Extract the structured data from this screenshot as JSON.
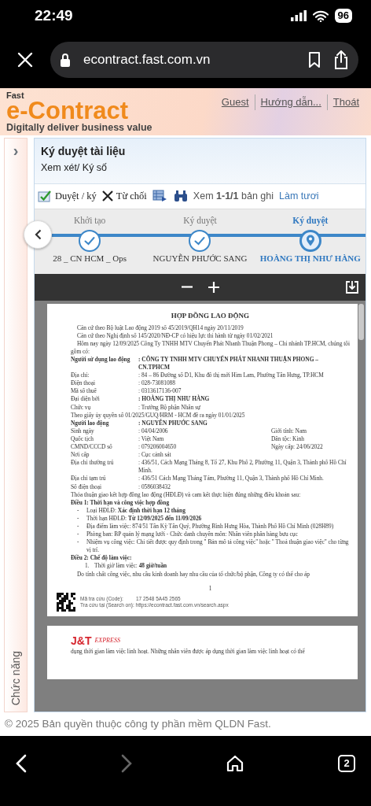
{
  "status_bar": {
    "time": "22:49",
    "battery": "96"
  },
  "browser": {
    "url": "econtract.fast.com.vn"
  },
  "header": {
    "brand_small": "Fast",
    "brand": "e-Contract",
    "tagline": "Digitally deliver business value",
    "links": [
      "Guest",
      "Hướng dẫn...",
      "Thoát"
    ]
  },
  "sidebar": {
    "toggle": "›",
    "label": "Chức năng"
  },
  "panel": {
    "title": "Ký duyệt tài liệu",
    "subtitle": "Xem xét/ Ký số"
  },
  "toolbar": {
    "actions": [
      {
        "kind": "approve",
        "label": "Duyệt / ký"
      },
      {
        "kind": "reject",
        "label": "Từ chối"
      },
      {
        "kind": "export"
      },
      {
        "kind": "find"
      }
    ],
    "records": "Xem **1-1/1** bản ghi",
    "refresh": "Làm tươi"
  },
  "steps": [
    {
      "label": "Khởi tạo",
      "name": "28 _ CN HCM _ Ops",
      "current": false
    },
    {
      "label": "Ký duyệt",
      "name": "NGUYỄN PHƯỚC SANG",
      "current": false
    },
    {
      "label": "Ký duyệt",
      "name": "HOÀNG THỊ NHƯ HÀNG",
      "current": true
    }
  ],
  "document": {
    "page1": [
      {
        "kind": "title",
        "text": "HỢP ĐỒNG LAO ĐỘNG"
      },
      {
        "kind": "para",
        "indent": true,
        "text": "Căn cứ theo Bộ luật Lao động 2019 số 45/2019/QH14 ngày 20/11/2019"
      },
      {
        "kind": "para",
        "indent": true,
        "text": "Căn cứ theo Nghị định số 145/2020/NĐ-CP có hiệu lực thi hành từ ngày 01/02/2021"
      },
      {
        "kind": "para",
        "indent": true,
        "text": "Hôm nay ngày 12/09/2025 Công Ty TNHH MTV Chuyển Phát Nhanh Thuận Phong – Chi nhánh TP.HCM, chúng tôi gồm có:"
      },
      {
        "kind": "field",
        "label": "Người sử dụng lao động",
        "value": ": CÔNG TY TNHH MTV CHUYỂN PHÁT NHANH THUẬN PHONG – CN.TPHCM",
        "label_bold": true,
        "value_bold": true
      },
      {
        "kind": "field",
        "label": "Địa chỉ:",
        "value": ": 84 – 86 Đường số D1, Khu đô thị mới Him Lam, Phường Tân Hưng, TP.HCM",
        "label_bold": false,
        "value_bold": false
      },
      {
        "kind": "field",
        "label": "Điện thoại",
        "value": ": 028-73081088",
        "label_bold": false,
        "value_bold": false
      },
      {
        "kind": "field",
        "label": "Mã số thuế",
        "value": ": 0313617136-007",
        "label_bold": false,
        "value_bold": false
      },
      {
        "kind": "field",
        "label": "Đại diện bởi",
        "value": ": HOÀNG THỊ NHƯ HÀNG",
        "label_bold": false,
        "value_bold": true
      },
      {
        "kind": "field",
        "label": "Chức vụ",
        "value": ": Trưởng Bộ phận Nhân sự",
        "label_bold": false,
        "value_bold": false
      },
      {
        "kind": "para",
        "indent": false,
        "text": "Theo giấy ủy quyền số 01/2025/GUQ/HRM - HCM đề ra ngày 01/01/2025"
      },
      {
        "kind": "field",
        "label": "Người lao động",
        "value": ": NGUYỄN PHƯỚC SANG",
        "label_bold": true,
        "value_bold": true
      },
      {
        "kind": "field",
        "label": "Sinh ngày",
        "value": ": 04/04/2006",
        "extra": "Giới tính: Nam",
        "label_bold": false,
        "value_bold": false
      },
      {
        "kind": "field",
        "label": "Quốc tịch",
        "value": ": Việt Nam",
        "extra": "Dân tộc: Kinh",
        "label_bold": false,
        "value_bold": false
      },
      {
        "kind": "field",
        "label": "CMND/CCCD số",
        "value": ": 079206004650",
        "extra": "Ngày cấp: 24/06/2022",
        "label_bold": false,
        "value_bold": false
      },
      {
        "kind": "field",
        "label": "Nơi cấp",
        "value": ": Cục cảnh sát",
        "label_bold": false,
        "value_bold": false
      },
      {
        "kind": "field",
        "label": "Địa chỉ thường trú",
        "value": ": 436/51, Cách Mạng Tháng 8, Tổ 27, Khu Phố 2, Phường 11, Quận 3, Thành phố Hồ Chí Minh.",
        "label_bold": false,
        "value_bold": false
      },
      {
        "kind": "field",
        "label": "Địa chỉ tạm trú",
        "value": ": 436/51 Cách Mạng Tháng Tám, Phường 11, Quận 3, Thành phố Hồ Chí Minh.",
        "label_bold": false,
        "value_bold": false
      },
      {
        "kind": "field",
        "label": "Số điện thoại",
        "value": ": 0586038432",
        "label_bold": false,
        "value_bold": false
      },
      {
        "kind": "para",
        "indent": false,
        "text": "Thỏa thuận giao kết hợp đồng lao động (HĐLĐ) và cam kết thực hiện đúng những điều khoản sau:"
      },
      {
        "kind": "heading",
        "text": "Điều 1: Thời hạn và công việc hợp đồng"
      },
      {
        "kind": "bullet",
        "marker": "-",
        "text": "Loại HĐLĐ: **Xác định thời hạn 12 tháng**"
      },
      {
        "kind": "bullet",
        "marker": "-",
        "text": "Thời hạn HĐLĐ: **Từ 12/09/2025 đến 11/09/2026**"
      },
      {
        "kind": "bullet",
        "marker": "-",
        "text": "Địa điểm làm việc: 874/51 Tân Kỳ Tân Quý, Phường Bình Hưng Hòa, Thành Phố Hồ Chí Minh (028H89)"
      },
      {
        "kind": "bullet",
        "marker": "-",
        "text": "Phòng ban: BP quản lý mạng lưới - Chức danh chuyên môn: Nhân viên phân hàng bưu cục"
      },
      {
        "kind": "bullet",
        "marker": "-",
        "text": "Nhiệm vụ công việc: Chi tiết được quy định trong \" Bản mô tả công việc\" hoặc \" Thoả thuận giao việc\" cho từng vị trí."
      },
      {
        "kind": "heading",
        "text": "Điều 2: Chế độ làm việc:"
      },
      {
        "kind": "numbered",
        "marker": "1.",
        "text": "Thời giờ làm việc: **48 giờ/tuần**"
      },
      {
        "kind": "para",
        "indent": true,
        "text": "Do tính chất công việc, nhu cầu kinh doanh hay nhu cầu của tổ chức/bộ phận, Công ty có thể cho áp"
      }
    ],
    "page_number": "1",
    "lookup_label": "Mã tra cứu (Code):",
    "lookup_code": "17 2548 5A45 2565",
    "search_line": "Tra cứu tại (Search on): https://econtract.fast.com.vn/search.aspx",
    "page2_logo": "J&T",
    "page2_logo_sub": "EXPRESS",
    "page2_text": "dụng thời gian làm việc linh hoạt. Những nhân viên được áp dụng thời gian làm việc linh hoạt có thể"
  },
  "footer": "© 2025 Bản quyền thuộc công ty phần mềm QLDN Fast.",
  "bottom_nav": [
    {
      "kind": "back",
      "disabled": false
    },
    {
      "kind": "forward",
      "disabled": true
    },
    {
      "kind": "home",
      "disabled": false
    },
    {
      "kind": "tabs",
      "count": "2",
      "disabled": false
    }
  ]
}
